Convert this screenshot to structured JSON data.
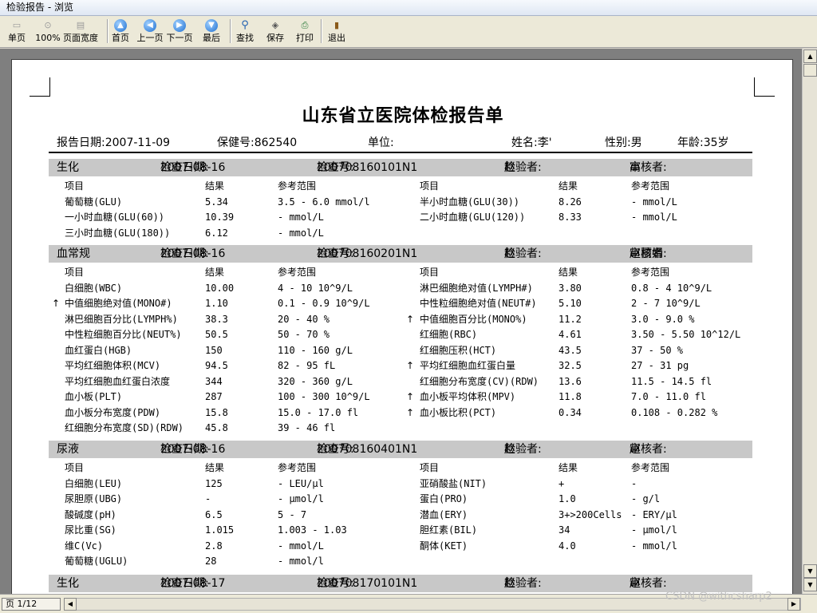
{
  "window": {
    "title": "检验报告 - 浏览"
  },
  "toolbar": [
    {
      "name": "single-page-button",
      "icon": "page-icon",
      "glyph": "▭",
      "label": "单页",
      "disabled": true
    },
    {
      "name": "zoom-100-button",
      "icon": "zoom-icon",
      "glyph": "⊙",
      "label": "100%",
      "disabled": true
    },
    {
      "name": "page-width-button",
      "icon": "page-width-icon",
      "glyph": "▤",
      "label": "页面宽度",
      "disabled": true
    },
    {
      "name": "first-page-button",
      "icon": "arrow-up-icon",
      "glyph": "▲",
      "label": "首页",
      "disabled": false
    },
    {
      "name": "prev-page-button",
      "icon": "arrow-left-icon",
      "glyph": "◀",
      "label": "上一页",
      "disabled": false
    },
    {
      "name": "next-page-button",
      "icon": "arrow-right-icon",
      "glyph": "▶",
      "label": "下一页",
      "disabled": false
    },
    {
      "name": "last-page-button",
      "icon": "arrow-down-icon",
      "glyph": "▼",
      "label": "最后",
      "disabled": false
    },
    {
      "name": "find-button",
      "icon": "magnifier-icon",
      "glyph": "⚲",
      "label": "查找",
      "disabled": false
    },
    {
      "name": "save-button",
      "icon": "save-icon",
      "glyph": "◈",
      "label": "保存",
      "disabled": false
    },
    {
      "name": "print-button",
      "icon": "printer-icon",
      "glyph": "⎙",
      "label": "打印",
      "disabled": false
    },
    {
      "name": "exit-button",
      "icon": "exit-door-icon",
      "glyph": "▮",
      "label": "退出",
      "disabled": false
    }
  ],
  "report": {
    "title": "山东省立医院体检报告单",
    "report_date_label": "报告日期:",
    "report_date": "2007-11-09",
    "insurance_label": "保健号:",
    "insurance_no": "862540",
    "unit_label": "单位:",
    "unit": "",
    "name_label": "姓名:",
    "name": "李'",
    "gender_label": "性别:",
    "gender": "男",
    "age_label": "年龄:",
    "age": "35岁",
    "col_headers": {
      "item": "项目",
      "result": "结果",
      "range": "参考范围"
    }
  },
  "sections": [
    {
      "name": "生化",
      "check_date_label": "检查日期:",
      "check_date": "2007-08-16",
      "check_no_label": "检查号:",
      "check_no": "200708160101N1",
      "tester_label": "检验者:",
      "tester": "赵",
      "reviewer_label": "审核者:",
      "reviewer": "高",
      "rows": [
        [
          {
            "item": "葡萄糖(GLU)",
            "result": "5.34",
            "range": "3.5 - 6.0  mmol/l",
            "flag": ""
          },
          {
            "item": "半小时血糖(GLU(30))",
            "result": "8.26",
            "range": "-  mmol/L",
            "flag": ""
          }
        ],
        [
          {
            "item": "一小时血糖(GLU(60))",
            "result": "10.39",
            "range": "-  mmol/L",
            "flag": ""
          },
          {
            "item": "二小时血糖(GLU(120))",
            "result": "8.33",
            "range": "-  mmol/L",
            "flag": ""
          }
        ],
        [
          {
            "item": "三小时血糖(GLU(180))",
            "result": "6.12",
            "range": "-  mmol/L",
            "flag": ""
          },
          null
        ]
      ]
    },
    {
      "name": "血常规",
      "check_date_label": "检查日期:",
      "check_date": "2007-08-16",
      "check_no_label": "检查号:",
      "check_no": "200708160201N1",
      "tester_label": "检验者:",
      "tester": "赵",
      "reviewer_label": "审核者:",
      "reviewer": "赵丽娟",
      "rows": [
        [
          {
            "item": "白细胞(WBC)",
            "result": "10.00",
            "range": "4 - 10  10^9/L",
            "flag": ""
          },
          {
            "item": "淋巴细胞绝对值(LYMPH#)",
            "result": "3.80",
            "range": "0.8 - 4  10^9/L",
            "flag": ""
          }
        ],
        [
          {
            "item": "中值细胞绝对值(MONO#)",
            "result": "1.10",
            "range": "0.1 - 0.9  10^9/L",
            "flag": "↑"
          },
          {
            "item": "中性粒细胞绝对值(NEUT#)",
            "result": "5.10",
            "range": "2 - 7  10^9/L",
            "flag": ""
          }
        ],
        [
          {
            "item": "淋巴细胞百分比(LYMPH%)",
            "result": "38.3",
            "range": "20 - 40  %",
            "flag": ""
          },
          {
            "item": "中值细胞百分比(MONO%)",
            "result": "11.2",
            "range": "3.0 - 9.0  %",
            "flag": "↑"
          }
        ],
        [
          {
            "item": "中性粒细胞百分比(NEUT%)",
            "result": "50.5",
            "range": "50 - 70  %",
            "flag": ""
          },
          {
            "item": "红细胞(RBC)",
            "result": "4.61",
            "range": "3.50 - 5.50  10^12/L",
            "flag": ""
          }
        ],
        [
          {
            "item": "血红蛋白(HGB)",
            "result": "150",
            "range": "110 - 160  g/L",
            "flag": ""
          },
          {
            "item": "红细胞压积(HCT)",
            "result": "43.5",
            "range": "37 - 50  %",
            "flag": ""
          }
        ],
        [
          {
            "item": "平均红细胞体积(MCV)",
            "result": "94.5",
            "range": "82 - 95  fL",
            "flag": ""
          },
          {
            "item": "平均红细胞血红蛋白量",
            "result": "32.5",
            "range": "27 - 31  pg",
            "flag": "↑"
          }
        ],
        [
          {
            "item": "平均红细胞血红蛋白浓度",
            "result": "344",
            "range": "320 - 360  g/L",
            "flag": ""
          },
          {
            "item": "红细胞分布宽度(CV)(RDW)",
            "result": "13.6",
            "range": "11.5 - 14.5  fl",
            "flag": ""
          }
        ],
        [
          {
            "item": "血小板(PLT)",
            "result": "287",
            "range": "100 - 300  10^9/L",
            "flag": ""
          },
          {
            "item": "血小板平均体积(MPV)",
            "result": "11.8",
            "range": "7.0 - 11.0  fl",
            "flag": "↑"
          }
        ],
        [
          {
            "item": "血小板分布宽度(PDW)",
            "result": "15.8",
            "range": "15.0 - 17.0  fl",
            "flag": ""
          },
          {
            "item": "血小板比积(PCT)",
            "result": "0.34",
            "range": "0.108 - 0.282  %",
            "flag": "↑"
          }
        ],
        [
          {
            "item": "红细胞分布宽度(SD)(RDW)",
            "result": "45.8",
            "range": "39 - 46  fl",
            "flag": ""
          },
          null
        ]
      ]
    },
    {
      "name": "尿液",
      "check_date_label": "检查日期:",
      "check_date": "2007-08-16",
      "check_no_label": "检查号:",
      "check_no": "200708160401N1",
      "tester_label": "检验者:",
      "tester": "赵",
      "reviewer_label": "审核者:",
      "reviewer": "赵",
      "rows": [
        [
          {
            "item": "白细胞(LEU)",
            "result": "125",
            "range": "-  LEU/μl",
            "flag": ""
          },
          {
            "item": "亚硝酸盐(NIT)",
            "result": "+",
            "range": "-",
            "flag": ""
          }
        ],
        [
          {
            "item": "尿胆原(UBG)",
            "result": "-",
            "range": "-  μmol/l",
            "flag": ""
          },
          {
            "item": "蛋白(PRO)",
            "result": "1.0",
            "range": "-  g/l",
            "flag": ""
          }
        ],
        [
          {
            "item": "酸碱度(pH)",
            "result": "6.5",
            "range": "5 - 7",
            "flag": ""
          },
          {
            "item": "潜血(ERY)",
            "result": "3+>200Cells",
            "range": "-  ERY/μl",
            "flag": ""
          }
        ],
        [
          {
            "item": "尿比重(SG)",
            "result": "1.015",
            "range": "1.003 - 1.03",
            "flag": ""
          },
          {
            "item": "胆红素(BIL)",
            "result": "34",
            "range": "-  μmol/l",
            "flag": ""
          }
        ],
        [
          {
            "item": "维C(Vc)",
            "result": "2.8",
            "range": "-  mmol/L",
            "flag": ""
          },
          {
            "item": "酮体(KET)",
            "result": "4.0",
            "range": "-  mmol/l",
            "flag": ""
          }
        ],
        [
          {
            "item": "葡萄糖(UGLU)",
            "result": "28",
            "range": "-  mmol/l",
            "flag": ""
          },
          null
        ]
      ]
    },
    {
      "name": "生化",
      "check_date_label": "检查日期:",
      "check_date": "2007-08-17",
      "check_no_label": "检查号:",
      "check_no": "200708170101N1",
      "tester_label": "检验者:",
      "tester": "赵",
      "reviewer_label": "审核者:",
      "reviewer": "赵",
      "rows": []
    }
  ],
  "status": {
    "page_indicator": "页 1/12"
  },
  "scroll": {
    "up_glyph": "▲",
    "down_glyph": "▼",
    "left_glyph": "◀",
    "right_glyph": "▶"
  },
  "watermark": "CSDN @withcsharp2"
}
